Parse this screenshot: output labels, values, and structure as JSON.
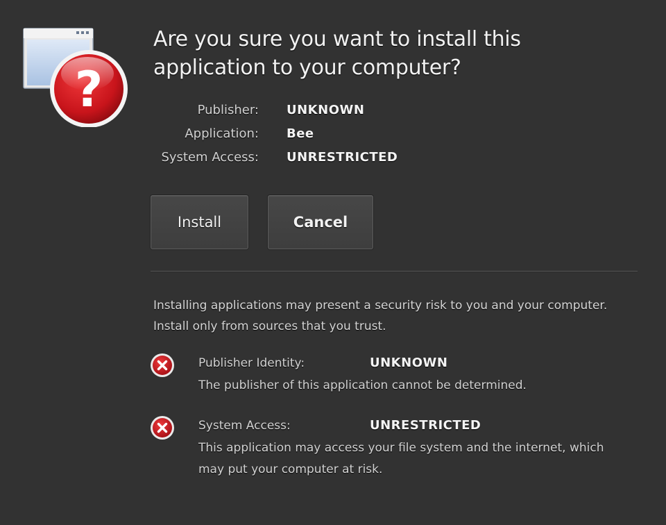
{
  "dialog": {
    "title": "Are you sure you want to install this application to your computer?",
    "icon": "install-question-icon",
    "details": [
      {
        "label": "Publisher:",
        "value": "UNKNOWN"
      },
      {
        "label": "Application:",
        "value": "Bee"
      },
      {
        "label": "System Access:",
        "value": "UNRESTRICTED"
      }
    ],
    "buttons": {
      "install_label": "Install",
      "cancel_label": "Cancel"
    },
    "warning_text": "Installing applications may present a security risk to you and your computer. Install only from sources that you trust.",
    "risks": [
      {
        "icon": "error-x-icon",
        "label": "Publisher Identity:",
        "value": "UNKNOWN",
        "description": "The publisher of this application cannot be determined."
      },
      {
        "icon": "error-x-icon",
        "label": "System Access:",
        "value": "UNRESTRICTED",
        "description": "This application may access your file system and the internet, which may put your computer at risk."
      }
    ]
  },
  "colors": {
    "background": "#323232",
    "text": "#e6e6e6",
    "error_red": "#c8141b",
    "button_bg": "#444444"
  }
}
